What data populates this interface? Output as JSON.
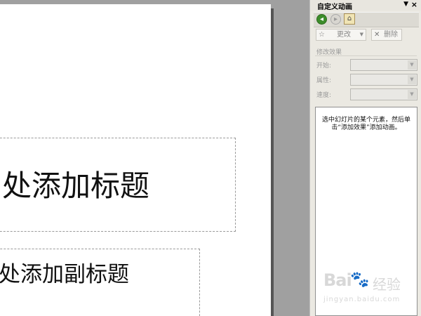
{
  "slide": {
    "title_placeholder": "处添加标题",
    "subtitle_placeholder": "处添加副标题"
  },
  "task_pane": {
    "title": "自定义动画",
    "menu_icon": "dropdown-arrow-icon",
    "close_icon": "close-icon",
    "nav": {
      "back_icon": "back-arrow-icon",
      "forward_icon": "forward-arrow-icon",
      "home_icon": "home-icon"
    },
    "change_button": "更改",
    "delete_button": "删除",
    "section_label": "修改效果",
    "properties": [
      {
        "label": "开始:",
        "value": ""
      },
      {
        "label": "属性:",
        "value": ""
      },
      {
        "label": "速度:",
        "value": ""
      }
    ],
    "hint": "选中幻灯片的某个元素，然后单击“添加效果”添加动画。"
  },
  "watermark": {
    "brand": "Bai",
    "word": "经验",
    "url": "jingyan.baidu.com"
  },
  "colors": {
    "pane_bg": "#ebe9e2",
    "workspace_bg": "#a0a0a0",
    "back_button": "#3c8d2a"
  }
}
